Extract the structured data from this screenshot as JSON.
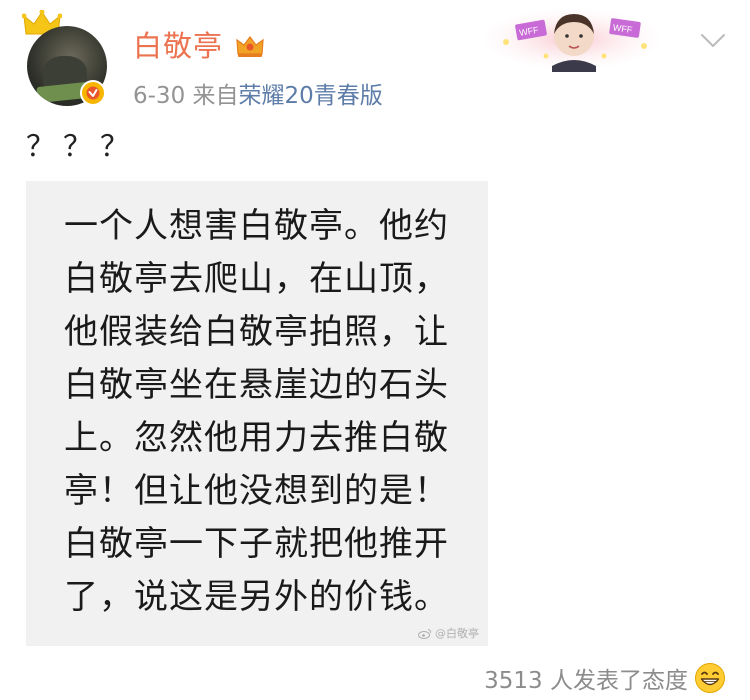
{
  "post": {
    "author": "白敬亭",
    "date": "6-30",
    "source_prefix": "来自",
    "source_device": "荣耀20青春版",
    "text": "？？？"
  },
  "image": {
    "quote": "一个人想害白敬亭。他约白敬亭去爬山，在山顶，他假装给白敬亭拍照，让白敬亭坐在悬崖边的石头上。忽然他用力去推白敬亭！但让他没想到的是！白敬亭一下子就把他推开了，说这是另外的价钱。",
    "watermark": "@白敬亭"
  },
  "banner": {
    "badge_text": "WFF"
  },
  "footer": {
    "reactions_text": "3513 人发表了态度"
  },
  "colors": {
    "author": "#eb7350",
    "source_link": "#5d7ca8",
    "meta": "#939393",
    "verified": "#f7b500"
  },
  "icons": [
    "crown-icon",
    "verified-badge-icon",
    "vip-crown-icon",
    "chevron-down-icon",
    "weibo-logo-icon",
    "grin-emoji-icon"
  ]
}
